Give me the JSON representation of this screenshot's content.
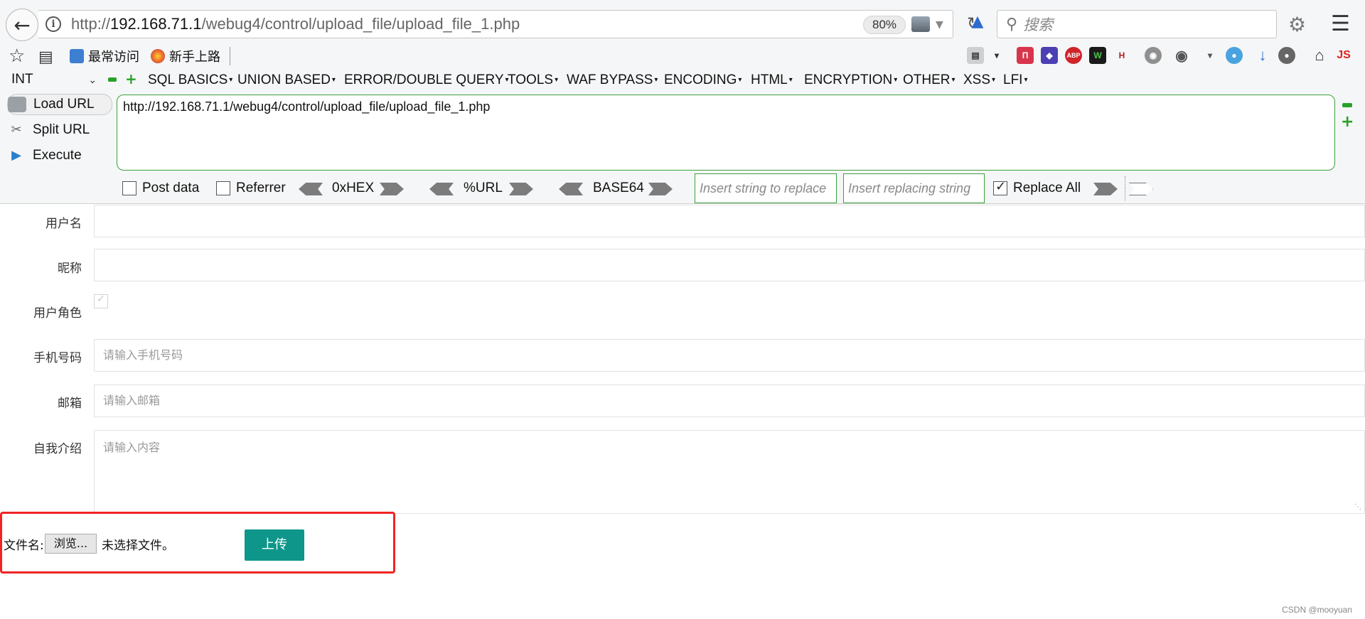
{
  "browser": {
    "url_prefix": "http://",
    "url_host": "192.168.71.1",
    "url_path": "/webug4/control/upload_file/upload_file_1.php",
    "zoom": "80%",
    "search_placeholder": "搜索"
  },
  "bookmarks": [
    {
      "label": "最常访问",
      "color": "#3d7fd1"
    },
    {
      "label": "新手上路",
      "color": "#e8612c"
    }
  ],
  "extensions": [
    {
      "name": "pocket-icon",
      "text": "П",
      "color": "#d8354d"
    },
    {
      "name": "stack-icon",
      "text": "◆",
      "color": "#4b3fb3"
    },
    {
      "name": "adblock-icon",
      "text": "ABP",
      "color": "#d0242b"
    },
    {
      "name": "shield-icon",
      "text": "W",
      "color": "#1a1a1a"
    },
    {
      "name": "hackbar-icon",
      "text": "H",
      "color": "#b01f1f"
    }
  ],
  "hackbar": {
    "select_value": "INT",
    "menus": [
      "SQL BASICS",
      "UNION BASED",
      "ERROR/DOUBLE QUERY",
      "TOOLS",
      "WAF BYPASS",
      "ENCODING",
      "HTML",
      "ENCRYPTION",
      "OTHER",
      "XSS",
      "LFI"
    ],
    "load_url": "Load URL",
    "split_url": "Split URL",
    "execute": "Execute",
    "url_value": "http://192.168.71.1/webug4/control/upload_file/upload_file_1.php",
    "post_data": "Post data",
    "referrer": "Referrer",
    "hex": "0xHEX",
    "url_enc": "%URL",
    "base64": "BASE64",
    "insert_placeholder": "Insert string to replace",
    "replacing_placeholder": "Insert replacing string",
    "replace_all": "Replace All"
  },
  "form": {
    "username_label": "用户名",
    "nickname_label": "昵称",
    "role_label": "用户角色",
    "phone_label": "手机号码",
    "phone_placeholder": "请输入手机号码",
    "email_label": "邮箱",
    "email_placeholder": "请输入邮箱",
    "intro_label": "自我介绍",
    "intro_placeholder": "请输入内容",
    "file_label": "文件名:",
    "browse_button": "浏览...",
    "no_file": "未选择文件。",
    "upload_button": "上传"
  },
  "watermark": "CSDN @mooyuan"
}
